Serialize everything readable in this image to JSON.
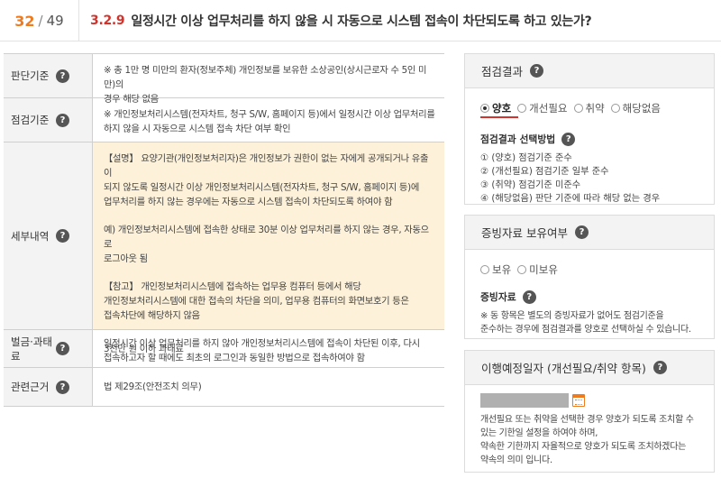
{
  "pager": {
    "current": "32",
    "separator": "/",
    "total": "49"
  },
  "question": {
    "code": "3.2.9",
    "text": "일정시간 이상 업무처리를 하지 않을 시 자동으로 시스템 접속이 차단되도록 하고 있는가?"
  },
  "rows": [
    {
      "label": "판단기준",
      "lines": [
        "※ 총 1만 명 미만의 환자(정보주체) 개인정보를 보유한 소상공인(상시근로자 수 5인 미만)의",
        "경우 해당 없음"
      ]
    },
    {
      "label": "점검기준",
      "lines": [
        "※ 개인정보처리시스템(전자차트, 청구 S/W, 홈페이지 등)에서 일정시간 이상 업무처리를",
        "하지 않을 시 자동으로 시스템 접속 차단 여부 확인"
      ]
    },
    {
      "label": "세부내역",
      "paragraphs": [
        [
          "【설명】 요양기관(개인정보처리자)은 개인정보가 권한이 없는 자에게 공개되거나 유출이",
          "되지 않도록 일정시간 이상 개인정보처리시스템(전자차트, 청구 S/W, 홈페이지 등)에",
          "업무처리를 하지 않는 경우에는 자동으로 시스템 접속이 차단되도록 하여야 함"
        ],
        [
          "예) 개인정보처리시스템에 접속한 상태로 30분 이상 업무처리를 하지 않는 경우, 자동으로",
          "로그아웃 됨"
        ],
        [
          "【참고】 개인정보처리시스템에 접속하는 업무용 컴퓨터 등에서 해당",
          "개인정보처리시스템에 대한 접속의 차단을 의미, 업무용 컴퓨터의 화면보호기 등은",
          "접속차단에 해당하지 않음"
        ],
        [
          "일정시간 이상 업무처리를 하지 않아 개인정보처리시스템에 접속이 차단된 이후, 다시",
          "접속하고자 할 때에도 최초의 로그인과 동일한 방법으로 접속하여야 함"
        ]
      ]
    },
    {
      "label": "벌금·과태료",
      "lines": [
        "3천만 원 이하 과태료"
      ]
    },
    {
      "label": "관련근거",
      "lines": [
        "법 제29조(안전조치 의무)"
      ]
    }
  ],
  "result_panel": {
    "title": "점검결과",
    "options": [
      "양호",
      "개선필요",
      "취약",
      "해당없음"
    ],
    "selected": "양호",
    "method_title": "점검결과 선택방법",
    "methods": [
      "① (양호) 점검기준 준수",
      "② (개선필요) 점검기준 일부 준수",
      "③ (취약) 점검기준 미준수",
      "④ (해당없음) 판단 기준에 따라 해당 없는 경우"
    ]
  },
  "evidence_panel": {
    "title": "증빙자료 보유여부",
    "options": [
      "보유",
      "미보유"
    ],
    "sub_title": "증빙자료",
    "note": [
      "※ 동 항목은 별도의 증빙자료가 없어도 점검기준을",
      "준수하는 경우에 점검결과를 양호로 선택하실 수 있습니다."
    ]
  },
  "schedule_panel": {
    "title": "이행예정일자 (개선필요/취약 항목)",
    "note": [
      "개선필요 또는 취약을 선택한 경우 양호가 되도록 조치할 수",
      "있는 기한일 설정을 하여야 하며,",
      "약속한 기한까지 자율적으로 양호가 되도록 조치하겠다는",
      "약속의 의미 입니다."
    ]
  },
  "help_glyph": "?"
}
